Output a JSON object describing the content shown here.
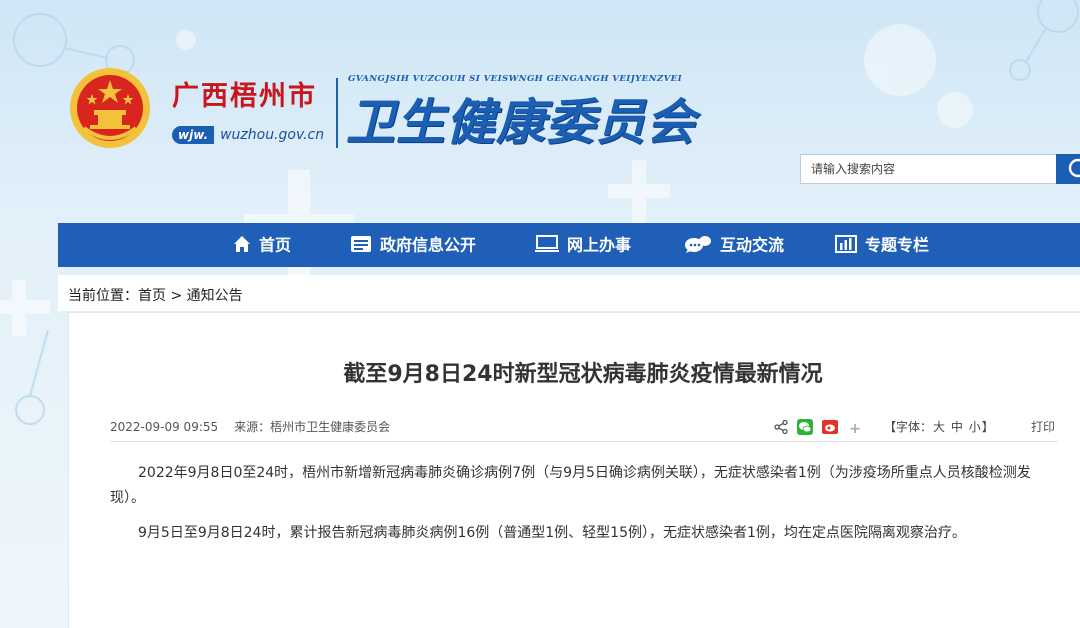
{
  "header": {
    "city_name": "广西梧州市",
    "domain_tag": "wjw.",
    "domain_text": "wuzhou.gov.cn",
    "zhuang_name": "GVANGJSIH VUZCOUH SI VEISWNGH GENGANGH VEIJYENZVEI",
    "org_name": "卫生健康委员会"
  },
  "search": {
    "placeholder": "请输入搜索内容"
  },
  "nav": {
    "items": [
      {
        "label": "首页",
        "icon": "home-icon"
      },
      {
        "label": "政府信息公开",
        "icon": "info-icon"
      },
      {
        "label": "网上办事",
        "icon": "monitor-icon"
      },
      {
        "label": "互动交流",
        "icon": "chat-icon"
      },
      {
        "label": "专题专栏",
        "icon": "bar-chart-icon"
      }
    ]
  },
  "breadcrumb": {
    "prefix": "当前位置：",
    "home": "首页",
    "separator": " > ",
    "current": "通知公告"
  },
  "article": {
    "title": "截至9月8日24时新型冠状病毒肺炎疫情最新情况",
    "date": "2022-09-09 09:55",
    "source": "来源：梧州市卫生健康委员会",
    "font_label_open": "【字体：",
    "font_large": "大",
    "font_medium": "中",
    "font_small": "小",
    "font_label_close": "】",
    "print": "打印",
    "paragraphs": [
      "2022年9月8日0至24时，梧州市新增新冠病毒肺炎确诊病例7例（与9月5日确诊病例关联），无症状感染者1例（为涉疫场所重点人员核酸检测发现）。",
      "9月5日至9月8日24时，累计报告新冠病毒肺炎病例16例（普通型1例、轻型15例），无症状感染者1例，均在定点医院隔离观察治疗。"
    ]
  },
  "colors": {
    "brand_blue": "#1f5fb8",
    "brand_red": "#c8161d"
  }
}
